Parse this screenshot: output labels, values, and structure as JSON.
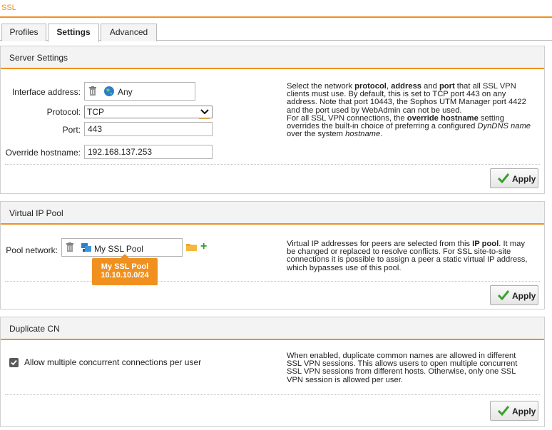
{
  "page": {
    "title": "SSL"
  },
  "tabs": [
    {
      "label": "Profiles"
    },
    {
      "label": "Settings"
    },
    {
      "label": "Advanced"
    }
  ],
  "server_settings": {
    "title": "Server Settings",
    "interface_label": "Interface address:",
    "interface_value": "Any",
    "protocol_label": "Protocol:",
    "protocol_value": "TCP",
    "port_label": "Port:",
    "port_value": "443",
    "override_label": "Override hostname:",
    "override_value": "192.168.137.253",
    "help": {
      "p1": "Select the network ",
      "b1": "protocol",
      "p2": ", ",
      "b2": "address",
      "p3": " and ",
      "b3": "port",
      "p4": " that all SSL VPN clients must use. By default, this is set to TCP port 443 on any address. Note that port 10443, the Sophos UTM Manager port 4422 and the port used by WebAdmin can not be used.",
      "p5": "For all SSL VPN connections, the ",
      "b4": "override hostname",
      "p6": " setting overrides the built-in choice of preferring a configured ",
      "i1": "DynDNS name",
      "p7": " over the system ",
      "i2": "hostname",
      "p8": "."
    },
    "apply_label": "Apply"
  },
  "virtual_ip_pool": {
    "title": "Virtual IP Pool",
    "pool_label": "Pool network:",
    "pool_value": "My SSL Pool",
    "tooltip_name": "My SSL Pool",
    "tooltip_network": "10.10.10.0/24",
    "help": {
      "p1": "Virtual IP addresses for peers are selected from this ",
      "b1": "IP pool",
      "p2": ". It may be changed or replaced to resolve conflicts. For SSL site-to-site connections it is possible to assign a peer a static virtual IP address, which bypasses use of this pool."
    },
    "apply_label": "Apply"
  },
  "duplicate_cn": {
    "title": "Duplicate CN",
    "checkbox_label": "Allow multiple concurrent connections per user",
    "checked": true,
    "help": "When enabled, duplicate common names are allowed in different SSL VPN sessions. This allows users to open multiple concurrent SSL VPN sessions from different hosts. Otherwise, only one SSL VPN session is allowed per user.",
    "apply_label": "Apply"
  },
  "colors": {
    "accent": "#f0901e",
    "apply_check": "#3aa02e",
    "add": "#2f9e2f",
    "network_icon": "#2a7fc8"
  }
}
